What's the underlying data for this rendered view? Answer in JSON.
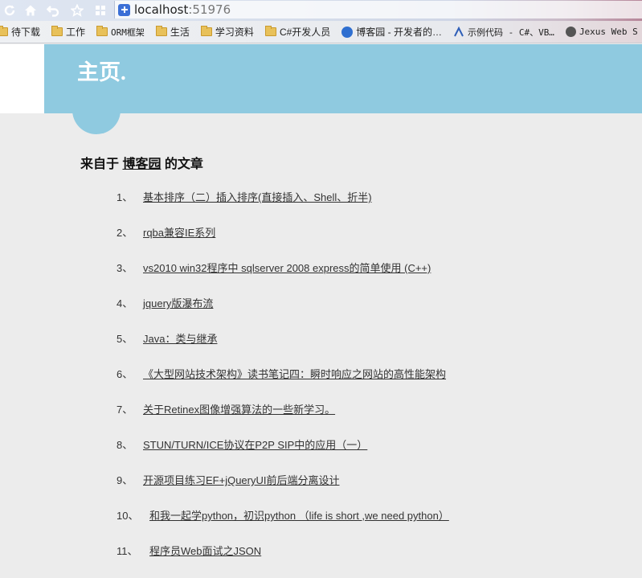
{
  "browser": {
    "url_host": "localhost",
    "url_port": ":51976",
    "bookmarks": [
      {
        "label": "待下载",
        "icon": "folder-icon"
      },
      {
        "label": "工作",
        "icon": "folder-icon"
      },
      {
        "label": "ORM框架",
        "icon": "folder-icon"
      },
      {
        "label": "生活",
        "icon": "folder-icon"
      },
      {
        "label": "学习资料",
        "icon": "folder-icon"
      },
      {
        "label": "C#开发人员",
        "icon": "folder-icon"
      },
      {
        "label": "博客园 - 开发者的…",
        "icon": "cnblogs-icon"
      },
      {
        "label": "示例代码 - C#、VB…",
        "icon": "code-sample-icon"
      },
      {
        "label": "Jexus Web S",
        "icon": "jexus-icon"
      }
    ]
  },
  "page": {
    "title": "主页.",
    "heading_prefix": "来自于 ",
    "heading_source": "博客园",
    "heading_suffix": " 的文章",
    "articles": [
      {
        "num": "1、",
        "title": "基本排序（二）插入排序(直接插入、Shell、折半)"
      },
      {
        "num": "2、",
        "title": "rqba兼容IE系列"
      },
      {
        "num": "3、",
        "title": "vs2010 win32程序中 sqlserver 2008 express的简单使用 (C++)"
      },
      {
        "num": "4、",
        "title": "jquery版瀑布流"
      },
      {
        "num": "5、",
        "title": "Java：类与继承"
      },
      {
        "num": "6、",
        "title": "《大型网站技术架构》读书笔记四：瞬时响应之网站的高性能架构"
      },
      {
        "num": "7、",
        "title": "关于Retinex图像增强算法的一些新学习。"
      },
      {
        "num": "8、",
        "title": "STUN/TURN/ICE协议在P2P SIP中的应用（一）"
      },
      {
        "num": "9、",
        "title": "开源项目练习EF+jQueryUI前后端分离设计"
      },
      {
        "num": "10、",
        "title": "和我一起学python，初识python （life is short ,we need python）"
      },
      {
        "num": "11、",
        "title": "程序员Web面试之JSON"
      }
    ]
  },
  "colors": {
    "banner": "#8fcae0",
    "page_background": "#ececec",
    "title_text": "#ffffff"
  }
}
